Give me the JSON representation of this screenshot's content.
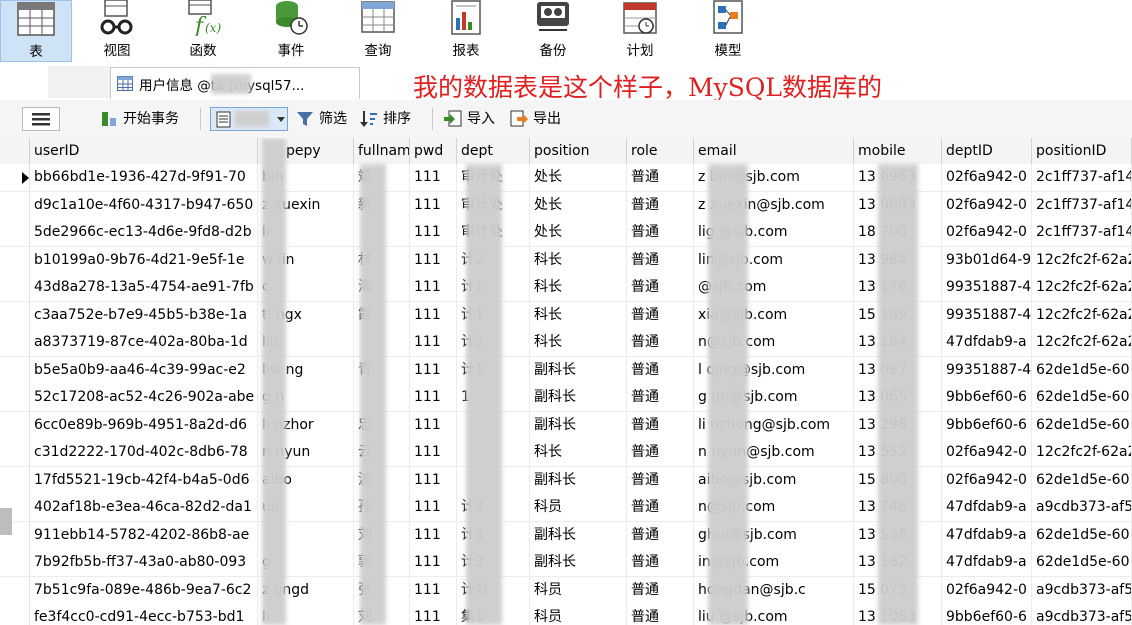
{
  "ribbon": {
    "buttons": [
      {
        "label": "表",
        "icon": "table-icon",
        "active": true
      },
      {
        "label": "视图",
        "icon": "view-glasses-icon"
      },
      {
        "label": "函数",
        "icon": "function-icon"
      },
      {
        "label": "事件",
        "icon": "event-clock-icon"
      },
      {
        "label": "查询",
        "icon": "query-icon"
      },
      {
        "label": "报表",
        "icon": "report-icon"
      },
      {
        "label": "备份",
        "icon": "backup-icon"
      },
      {
        "label": "计划",
        "icon": "schedule-icon"
      },
      {
        "label": "模型",
        "icon": "model-icon"
      }
    ]
  },
  "tab": {
    "label": "用户信息 @ta (mysql57..."
  },
  "note": "我的数据表是这个样子，MySQL数据库的",
  "toolbar": {
    "begin_tx": "开始事务",
    "filter": "筛选",
    "sort": "排序",
    "import": "导入",
    "export": "导出"
  },
  "columns": [
    "userID",
    "pepy",
    "fullnam",
    "pwd",
    "dept",
    "position",
    "role",
    "email",
    "mobile",
    "deptID",
    "positionID"
  ],
  "rows": [
    {
      "userID": "bb66bd1e-1936-427d-9f91-70",
      "pepy": "bin",
      "fullname": "斌",
      "pwd": "111",
      "dept": "审计处",
      "position": "处长",
      "role": "普通",
      "email": "z    bin@sjb.com",
      "mobile": "13      0963",
      "deptID": "02f6a942-0",
      "positionID": "2c1ff737-af14"
    },
    {
      "userID": "d9c1a10e-4f60-4317-b947-650",
      "pepy": "z   xuexin",
      "fullname": "新",
      "pwd": "111",
      "dept": "审计处",
      "position": "处长",
      "role": "普通",
      "email": "z    xuexin@sjb.com",
      "mobile": "13      9093",
      "deptID": "02f6a942-0",
      "positionID": "2c1ff737-af14"
    },
    {
      "userID": "5de2966c-ec13-4d6e-9fd8-d2b",
      "pepy": "li    ",
      "fullname": "",
      "pwd": "111",
      "dept": "审计处",
      "position": "处长",
      "role": "普通",
      "email": "lig    @sjb.com",
      "mobile": "18      700",
      "deptID": "02f6a942-0",
      "positionID": "2c1ff737-af14"
    },
    {
      "userID": "b10199a0-9b76-4d21-9e5f-1e",
      "pepy": "w     lin",
      "fullname": "林",
      "pwd": "111",
      "dept": "计2",
      "position": "科长",
      "role": "普通",
      "email": "     lin@sjb.com",
      "mobile": "13      984",
      "deptID": "93b01d64-9",
      "positionID": "12c2fc2f-62a2"
    },
    {
      "userID": "43d8a278-13a5-4754-ae91-7fb",
      "pepy": "c   ",
      "fullname": "海",
      "pwd": "111",
      "dept": "计1",
      "position": "科长",
      "role": "普通",
      "email": "     @sjb.com",
      "mobile": "13      176",
      "deptID": "99351887-4",
      "positionID": "12c2fc2f-62a2"
    },
    {
      "userID": "c3aa752e-b7e9-45b5-b38e-1a",
      "pepy": "ti   ngx",
      "fullname": "霞",
      "pwd": "111",
      "dept": "计1",
      "position": "科长",
      "role": "普通",
      "email": "     xia@sjb.com",
      "mobile": "15      189",
      "deptID": "99351887-4",
      "positionID": "12c2fc2f-62a2"
    },
    {
      "userID": "a8373719-87ce-402a-80ba-1d",
      "pepy": "liu  ",
      "fullname": "",
      "pwd": "111",
      "dept": "计3",
      "position": "科长",
      "role": "普通",
      "email": "    n@sjb.com",
      "mobile": "13      184",
      "deptID": "47dfdab9-a",
      "positionID": "12c2fc2f-62a2"
    },
    {
      "userID": "b5e5a0b9-aa46-4c39-99ac-e2",
      "pepy": "liw   ng",
      "fullname": "青",
      "pwd": "111",
      "dept": "计1",
      "position": "副科长",
      "role": "普通",
      "email": "l    qing@sjb.com",
      "mobile": "13      087",
      "deptID": "99351887-4",
      "positionID": "62de1d5e-60"
    },
    {
      "userID": "52c17208-ac52-4c26-902a-abe",
      "pepy": "g    n",
      "fullname": "",
      "pwd": "111",
      "dept": "1",
      "position": "副科长",
      "role": "普通",
      "email": "g    un@sjb.com",
      "mobile": "13      065",
      "deptID": "9bb6ef60-6",
      "positionID": "62de1d5e-60"
    },
    {
      "userID": "6cc0e89b-969b-4951-8a2d-d6",
      "pepy": "li   nzhor",
      "fullname": "忠",
      "pwd": "111",
      "dept": "",
      "position": "副科长",
      "role": "普通",
      "email": "li    nzhong@sjb.com",
      "mobile": "13      298",
      "deptID": "9bb6ef60-6",
      "positionID": "62de1d5e-60"
    },
    {
      "userID": "c31d2222-170d-402c-8db6-78",
      "pepy": "n   nyun",
      "fullname": "云",
      "pwd": "111",
      "dept": "",
      "position": "科长",
      "role": "普通",
      "email": "n    nyun@sjb.com",
      "mobile": "13      552",
      "deptID": "02f6a942-0",
      "positionID": "12c2fc2f-62a2"
    },
    {
      "userID": "17fd5521-19cb-42f4-b4a5-0d6",
      "pepy": "  aibo",
      "fullname": "波",
      "pwd": "111",
      "dept": "",
      "position": "副科长",
      "role": "普通",
      "email": "    aibo@sjb.com",
      "mobile": "15      800",
      "deptID": "02f6a942-0",
      "positionID": "62de1d5e-60"
    },
    {
      "userID": "402af18b-e3ea-46ca-82d2-da1",
      "pepy": "  ua",
      "fullname": "孙",
      "pwd": "111",
      "dept": "计3",
      "position": "科员",
      "role": "普通",
      "email": "     n@sjb.com",
      "mobile": "13      746",
      "deptID": "47dfdab9-a",
      "positionID": "a9cdb373-af5"
    },
    {
      "userID": "911ebb14-5782-4202-86b8-ae",
      "pepy": "   ",
      "fullname": "刘",
      "pwd": "111",
      "dept": "计3",
      "position": "副科长",
      "role": "普通",
      "email": "    ghui@sjb.com",
      "mobile": "13      536",
      "deptID": "47dfdab9-a",
      "positionID": "62de1d5e-60"
    },
    {
      "userID": "7b92fb5b-ff37-43a0-ab80-093",
      "pepy": "g  ",
      "fullname": "郭",
      "pwd": "111",
      "dept": "计3",
      "position": "副科长",
      "role": "普通",
      "email": "     in@sjb.com",
      "mobile": "13      182",
      "deptID": "47dfdab9-a",
      "positionID": "62de1d5e-60"
    },
    {
      "userID": "7b51c9fa-089e-486b-9ea7-6c2",
      "pepy": "z    ongd",
      "fullname": "张",
      "pwd": "111",
      "dept": "计处",
      "position": "科员",
      "role": "普通",
      "email": "     hongdan@sjb.c",
      "mobile": "15      075",
      "deptID": "02f6a942-0",
      "positionID": "a9cdb373-af5"
    },
    {
      "userID": "fe3f4cc0-cd91-4ecc-b753-bd1",
      "pepy": "li   ",
      "fullname": "刘",
      "pwd": "111",
      "dept": "集1",
      "position": "科员",
      "role": "普通",
      "email": "liu    @sjb.com",
      "mobile": "13      1083",
      "deptID": "9bb6ef60-6",
      "positionID": "a9cdb373-af5"
    }
  ]
}
